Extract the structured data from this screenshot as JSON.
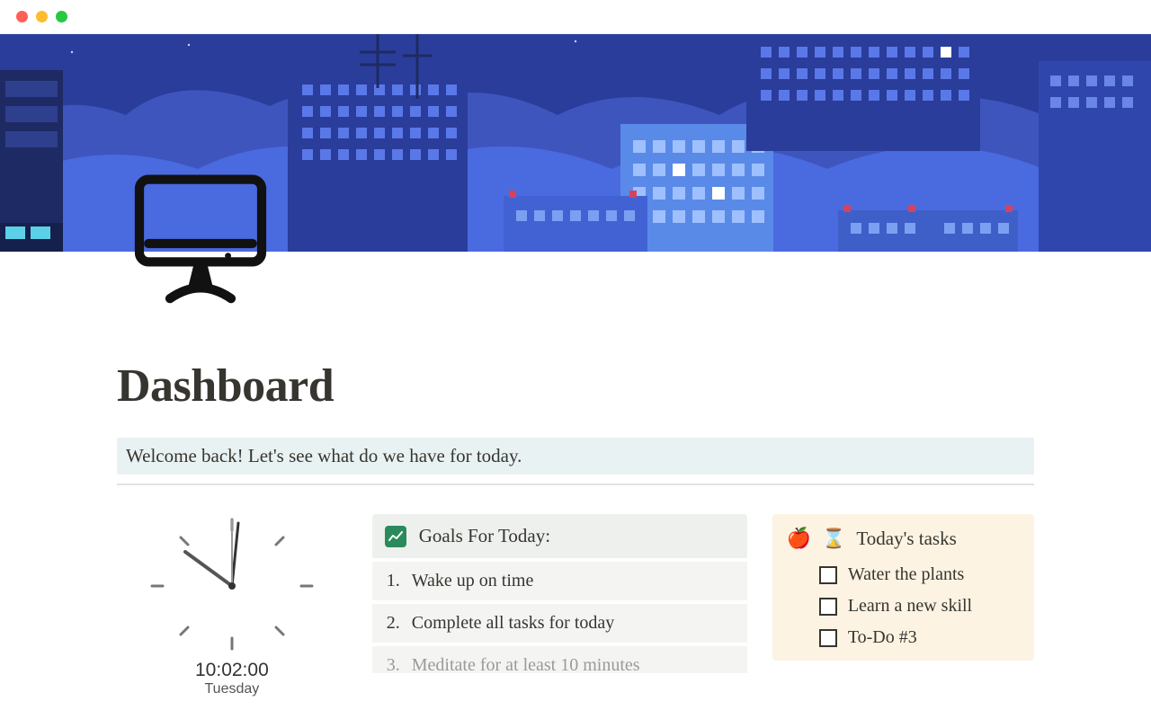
{
  "page": {
    "title": "Dashboard",
    "welcome": "Welcome back! Let's see what do we have for today."
  },
  "clock": {
    "time": "10:02:00",
    "day": "Tuesday"
  },
  "goals": {
    "header": "Goals For Today:",
    "items": [
      {
        "num": "1.",
        "text": "Wake up on time"
      },
      {
        "num": "2.",
        "text": "Complete all tasks for today"
      },
      {
        "num": "3.",
        "text": "Meditate for at least 10 minutes"
      }
    ]
  },
  "tasks": {
    "header_icon": "⌛",
    "header": "Today's tasks",
    "items": [
      {
        "label": "Water the plants"
      },
      {
        "label": "Learn a new skill"
      },
      {
        "label": "To-Do #3"
      }
    ]
  }
}
